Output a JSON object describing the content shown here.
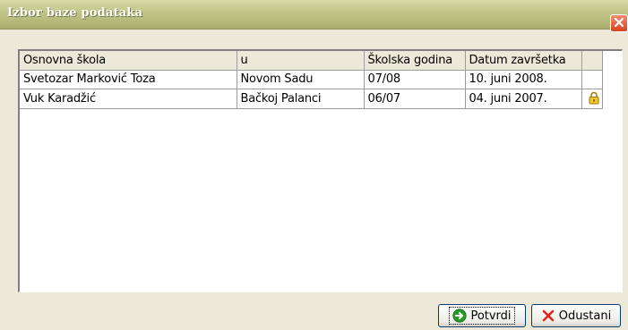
{
  "window": {
    "title": "Izbor baze podataka"
  },
  "grid": {
    "columns": [
      "Osnovna škola",
      "u",
      "Školska godina",
      "Datum završetka",
      ""
    ],
    "rows": [
      {
        "school": "Svetozar Marković Toza",
        "place": "Novom Sadu",
        "year": "07/08",
        "end_date": "10. juni 2008.",
        "locked": false
      },
      {
        "school": "Vuk Karadžić",
        "place": "Bačkoj Palanci",
        "year": "06/07",
        "end_date": "04. juni 2007.",
        "locked": true
      }
    ]
  },
  "buttons": {
    "confirm_label": "Potvrdi",
    "cancel_label": "Odustani"
  },
  "icons": {
    "close": "close-icon",
    "confirm": "arrow-right-circle-icon",
    "cancel": "x-icon",
    "lock": "padlock-icon"
  },
  "colors": {
    "titlebar": "#b6bb7b",
    "close_button": "#d7431f",
    "confirm_icon": "#2a9a2a",
    "cancel_icon": "#e0261b",
    "lock_icon": "#e7b420"
  }
}
